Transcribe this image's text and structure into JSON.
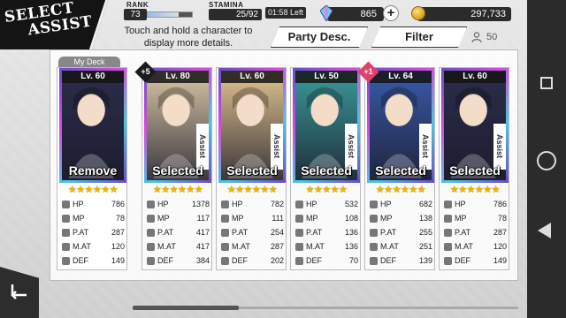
{
  "header": {
    "title_line1": "SELECT",
    "title_line2": "ASSIST",
    "rank_label": "RANK",
    "rank_value": "73",
    "stamina_label": "STAMINA",
    "stamina_value": "25/92",
    "stamina_timer": "01:58 Left",
    "gems": "865",
    "coins": "297,733",
    "hint": "Touch and hold a character to display more details.",
    "party_desc_label": "Party Desc.",
    "filter_label": "Filter",
    "owned_count": "50"
  },
  "deck_tab_label": "My Deck",
  "cards": [
    {
      "level": "Lv. 60",
      "state": "Remove",
      "plus": "",
      "stars": "★★★★★★",
      "hp": "786",
      "mp": "78",
      "pat": "287",
      "mat": "120",
      "def": "149",
      "portrait_bg": "#2b2d4a"
    },
    {
      "level": "Lv. 80",
      "state": "Selected",
      "plus": "+5",
      "stars": "★★★★★★",
      "hp": "1378",
      "mp": "117",
      "pat": "417",
      "mat": "417",
      "def": "384",
      "portrait_bg": "#d9c6a5"
    },
    {
      "level": "Lv. 60",
      "state": "Selected",
      "plus": "",
      "stars": "★★★★★★",
      "hp": "782",
      "mp": "111",
      "pat": "254",
      "mat": "287",
      "def": "202",
      "portrait_bg": "#e2c48f"
    },
    {
      "level": "Lv. 50",
      "state": "Selected",
      "plus": "",
      "stars": "★★★★★",
      "hp": "532",
      "mp": "108",
      "pat": "136",
      "mat": "136",
      "def": "70",
      "portrait_bg": "#3a9a9a"
    },
    {
      "level": "Lv. 64",
      "state": "Selected",
      "plus": "+1",
      "stars": "★★★★★★",
      "hp": "682",
      "mp": "138",
      "pat": "255",
      "mat": "251",
      "def": "139",
      "portrait_bg": "#3a5aa8"
    },
    {
      "level": "Lv. 60",
      "state": "Selected",
      "plus": "",
      "stars": "★★★★★★",
      "hp": "786",
      "mp": "78",
      "pat": "287",
      "mat": "120",
      "def": "149",
      "portrait_bg": "#2b2d4a"
    }
  ],
  "stat_labels": {
    "hp": "HP",
    "mp": "MP",
    "pat": "P.AT",
    "mat": "M.AT",
    "def": "DEF"
  },
  "assist_label": "Assist",
  "colors": {
    "accent_gold": "#f0b400",
    "panel_dark": "#2b2b2b"
  }
}
